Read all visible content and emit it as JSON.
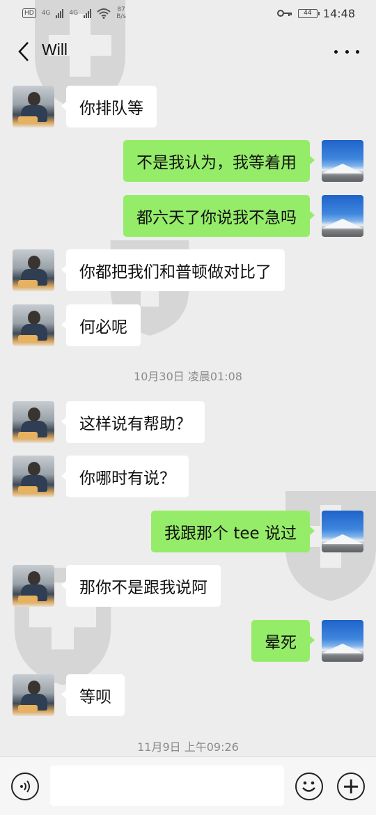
{
  "status_bar": {
    "left_chip": "HD",
    "net1": "4G",
    "net2": "4G",
    "speed_value": "87",
    "speed_unit": "B/s",
    "battery": "44",
    "time": "14:48",
    "icons": [
      "hd-icon",
      "signal-icon",
      "signal-icon",
      "wifi-icon",
      "key-icon",
      "battery-icon"
    ]
  },
  "header": {
    "title": "Will",
    "back_icon": "chevron-left-icon",
    "more_icon": "more-dots-icon"
  },
  "messages": [
    {
      "sender": "other",
      "text": "你排队等"
    },
    {
      "sender": "self",
      "text": "不是我认为，我等着用"
    },
    {
      "sender": "self",
      "text": "都六天了你说我不急吗"
    },
    {
      "sender": "other",
      "text": "你都把我们和普顿做对比了"
    },
    {
      "sender": "other",
      "text": "何必呢"
    },
    {
      "type": "timestamp",
      "text": "10月30日 凌晨01:08"
    },
    {
      "sender": "other",
      "text": "这样说有帮助？"
    },
    {
      "sender": "other",
      "text": "你哪时有说？"
    },
    {
      "sender": "self",
      "text": "我跟那个 tee 说过"
    },
    {
      "sender": "other",
      "text": "那你不是跟我说阿"
    },
    {
      "sender": "self",
      "text": "晕死"
    },
    {
      "sender": "other",
      "text": "等呗"
    },
    {
      "type": "timestamp",
      "text": "11月9日 上午09:26"
    }
  ],
  "input_bar": {
    "value": "",
    "voice_icon": "voice-icon",
    "emoji_icon": "emoji-icon",
    "plus_icon": "plus-icon"
  },
  "colors": {
    "background": "#ededed",
    "self_bubble": "#95ec69",
    "other_bubble": "#ffffff"
  }
}
